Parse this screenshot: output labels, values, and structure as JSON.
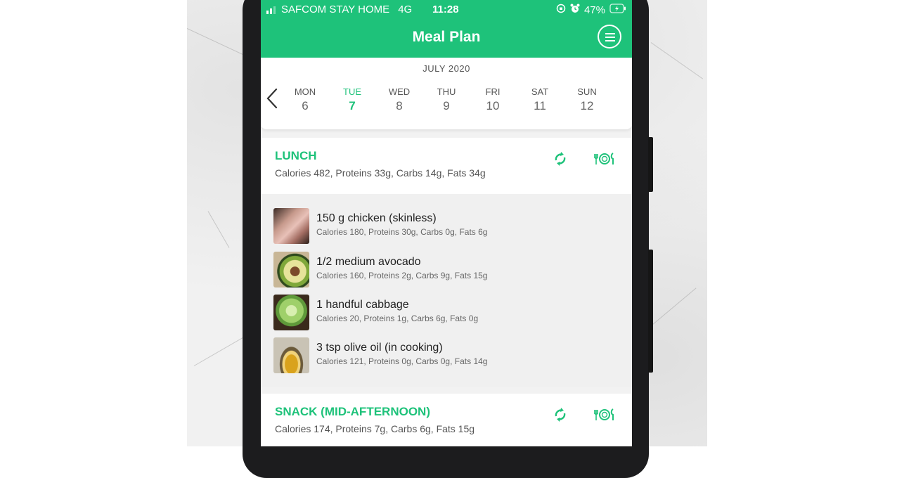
{
  "status_bar": {
    "carrier": "SAFCOM STAY HOME",
    "network": "4G",
    "time": "11:28",
    "battery": "47%",
    "icons": [
      "signal-icon",
      "lock-rotation-icon",
      "alarm-icon",
      "battery-charging-icon"
    ]
  },
  "header": {
    "title": "Meal Plan",
    "menu_icon": "hamburger-menu-icon"
  },
  "week": {
    "month": "JULY 2020",
    "days": [
      {
        "name": "MON",
        "date": "6"
      },
      {
        "name": "TUE",
        "date": "7",
        "selected": true
      },
      {
        "name": "WED",
        "date": "8"
      },
      {
        "name": "THU",
        "date": "9"
      },
      {
        "name": "FRI",
        "date": "10"
      },
      {
        "name": "SAT",
        "date": "11"
      },
      {
        "name": "SUN",
        "date": "12"
      }
    ]
  },
  "meals": [
    {
      "title": "LUNCH",
      "summary": "Calories 482, Proteins 33g, Carbs 14g, Fats 34g",
      "items": [
        {
          "name": "150 g chicken (skinless)",
          "macros": "Calories 180, Proteins 30g, Carbs 0g, Fats 6g"
        },
        {
          "name": "1/2 medium avocado",
          "macros": "Calories 160, Proteins 2g, Carbs 9g, Fats 15g"
        },
        {
          "name": "1 handful cabbage",
          "macros": "Calories 20, Proteins 1g, Carbs 6g, Fats 0g"
        },
        {
          "name": "3 tsp olive oil (in cooking)",
          "macros": "Calories 121, Proteins 0g, Carbs 0g, Fats 14g"
        }
      ]
    },
    {
      "title": "SNACK (MID-AFTERNOON)",
      "summary": "Calories 174, Proteins 7g, Carbs 6g, Fats 15g"
    }
  ],
  "colors": {
    "accent": "#1ec27a",
    "text_dark": "#222222",
    "text_muted": "#555555",
    "frame": "#1c1c1e"
  }
}
